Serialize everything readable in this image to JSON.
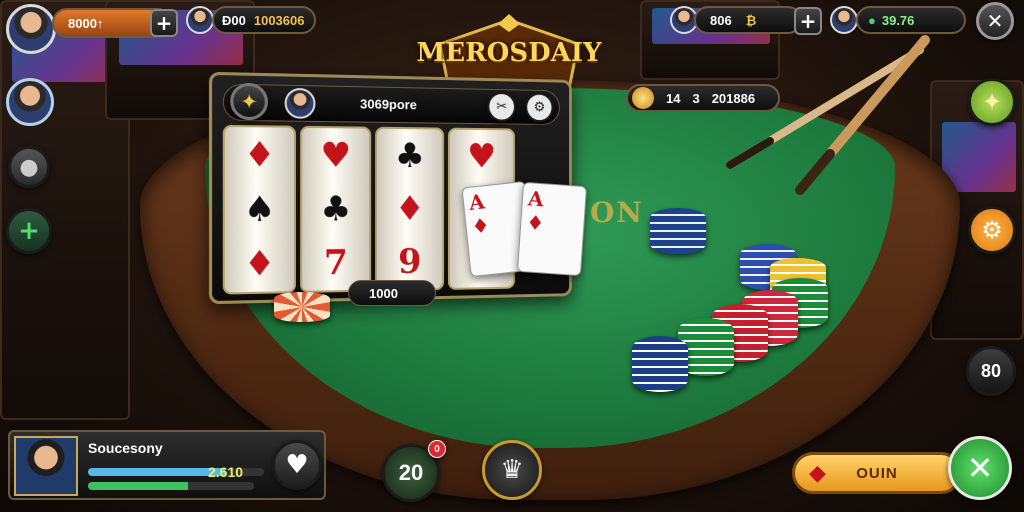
{
  "logo": {
    "text": "MEROSDAIY"
  },
  "top_left": {
    "coins": "8000↑"
  },
  "top_center": {
    "left_value": "Đ00",
    "right_value": "1003606"
  },
  "top_right": {
    "value_a": "806",
    "value_b": "₿",
    "gems": "39.76"
  },
  "slot": {
    "title": "3069pore"
  },
  "pot": {
    "left": "14",
    "mid": "3",
    "right": "201886"
  },
  "bet_label": "1000",
  "player": {
    "name": "Soucesony",
    "value": "2.610"
  },
  "bottom_center": {
    "count": "20",
    "badge": "0"
  },
  "right_rail": {
    "round_label": "80"
  },
  "action": {
    "label": "OUIN"
  },
  "felt_text": "ON",
  "progress": {
    "blue": 0.78,
    "green": 0.6
  },
  "colors": {
    "gold": "#d6b24a",
    "felt": "#1d7a3d",
    "action": "#f0a62a",
    "confirm": "#2fa84a"
  }
}
